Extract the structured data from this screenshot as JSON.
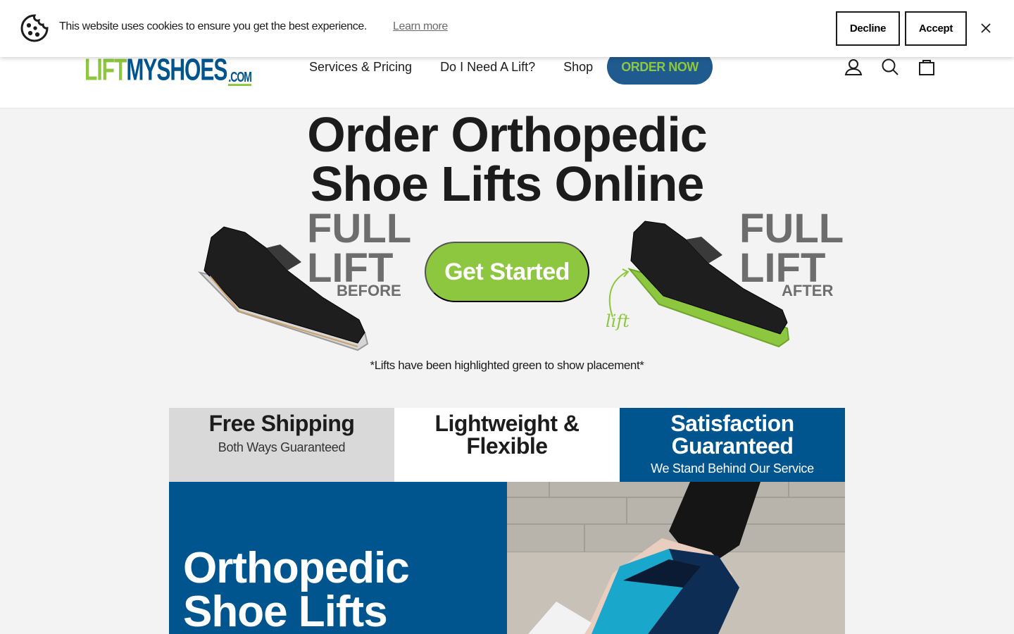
{
  "cookie_bar": {
    "message": "This website uses cookies to ensure you get the best experience.",
    "learn_more": "Learn more",
    "decline": "Decline",
    "accept": "Accept",
    "icons": {
      "cookie": "cookie-icon",
      "close": "close-icon"
    }
  },
  "header": {
    "logo": {
      "part1": "LIFT",
      "part2": "MYSHOES",
      "part3": ".COM"
    },
    "nav": [
      {
        "label": "Services & Pricing"
      },
      {
        "label": "Do I Need A Lift?"
      },
      {
        "label": "Shop"
      }
    ],
    "order_button": "ORDER NOW",
    "icons": [
      "account-icon",
      "search-icon",
      "cart-icon"
    ]
  },
  "hero": {
    "title_line1": "Order Orthopedic",
    "title_line2": "Shoe Lifts Online",
    "before_label_1": "FULL",
    "before_label_2": "LIFT",
    "before_label_3": "BEFORE",
    "after_label_1": "FULL",
    "after_label_2": "LIFT",
    "after_label_3": "AFTER",
    "lift_annotation": "lift",
    "cta": "Get Started",
    "note": "*Lifts have been highlighted green to show placement*"
  },
  "features": [
    {
      "title": "Free Shipping",
      "subtitle": "Both Ways Guaranteed"
    },
    {
      "title_line1": "Lightweight &",
      "title_line2": "Flexible"
    },
    {
      "title_line1": "Satisfaction",
      "title_line2": "Guaranteed",
      "subtitle": "We Stand Behind Our Service"
    }
  ],
  "banner": {
    "title_line1": "Orthopedic",
    "title_line2": "Shoe Lifts"
  },
  "colors": {
    "brand_blue": "#00558e",
    "brand_green": "#8dc63f",
    "order_button_bg": "#1f5b8f",
    "text_dark": "#1c1c1c",
    "page_bg": "#f3f3f3"
  }
}
